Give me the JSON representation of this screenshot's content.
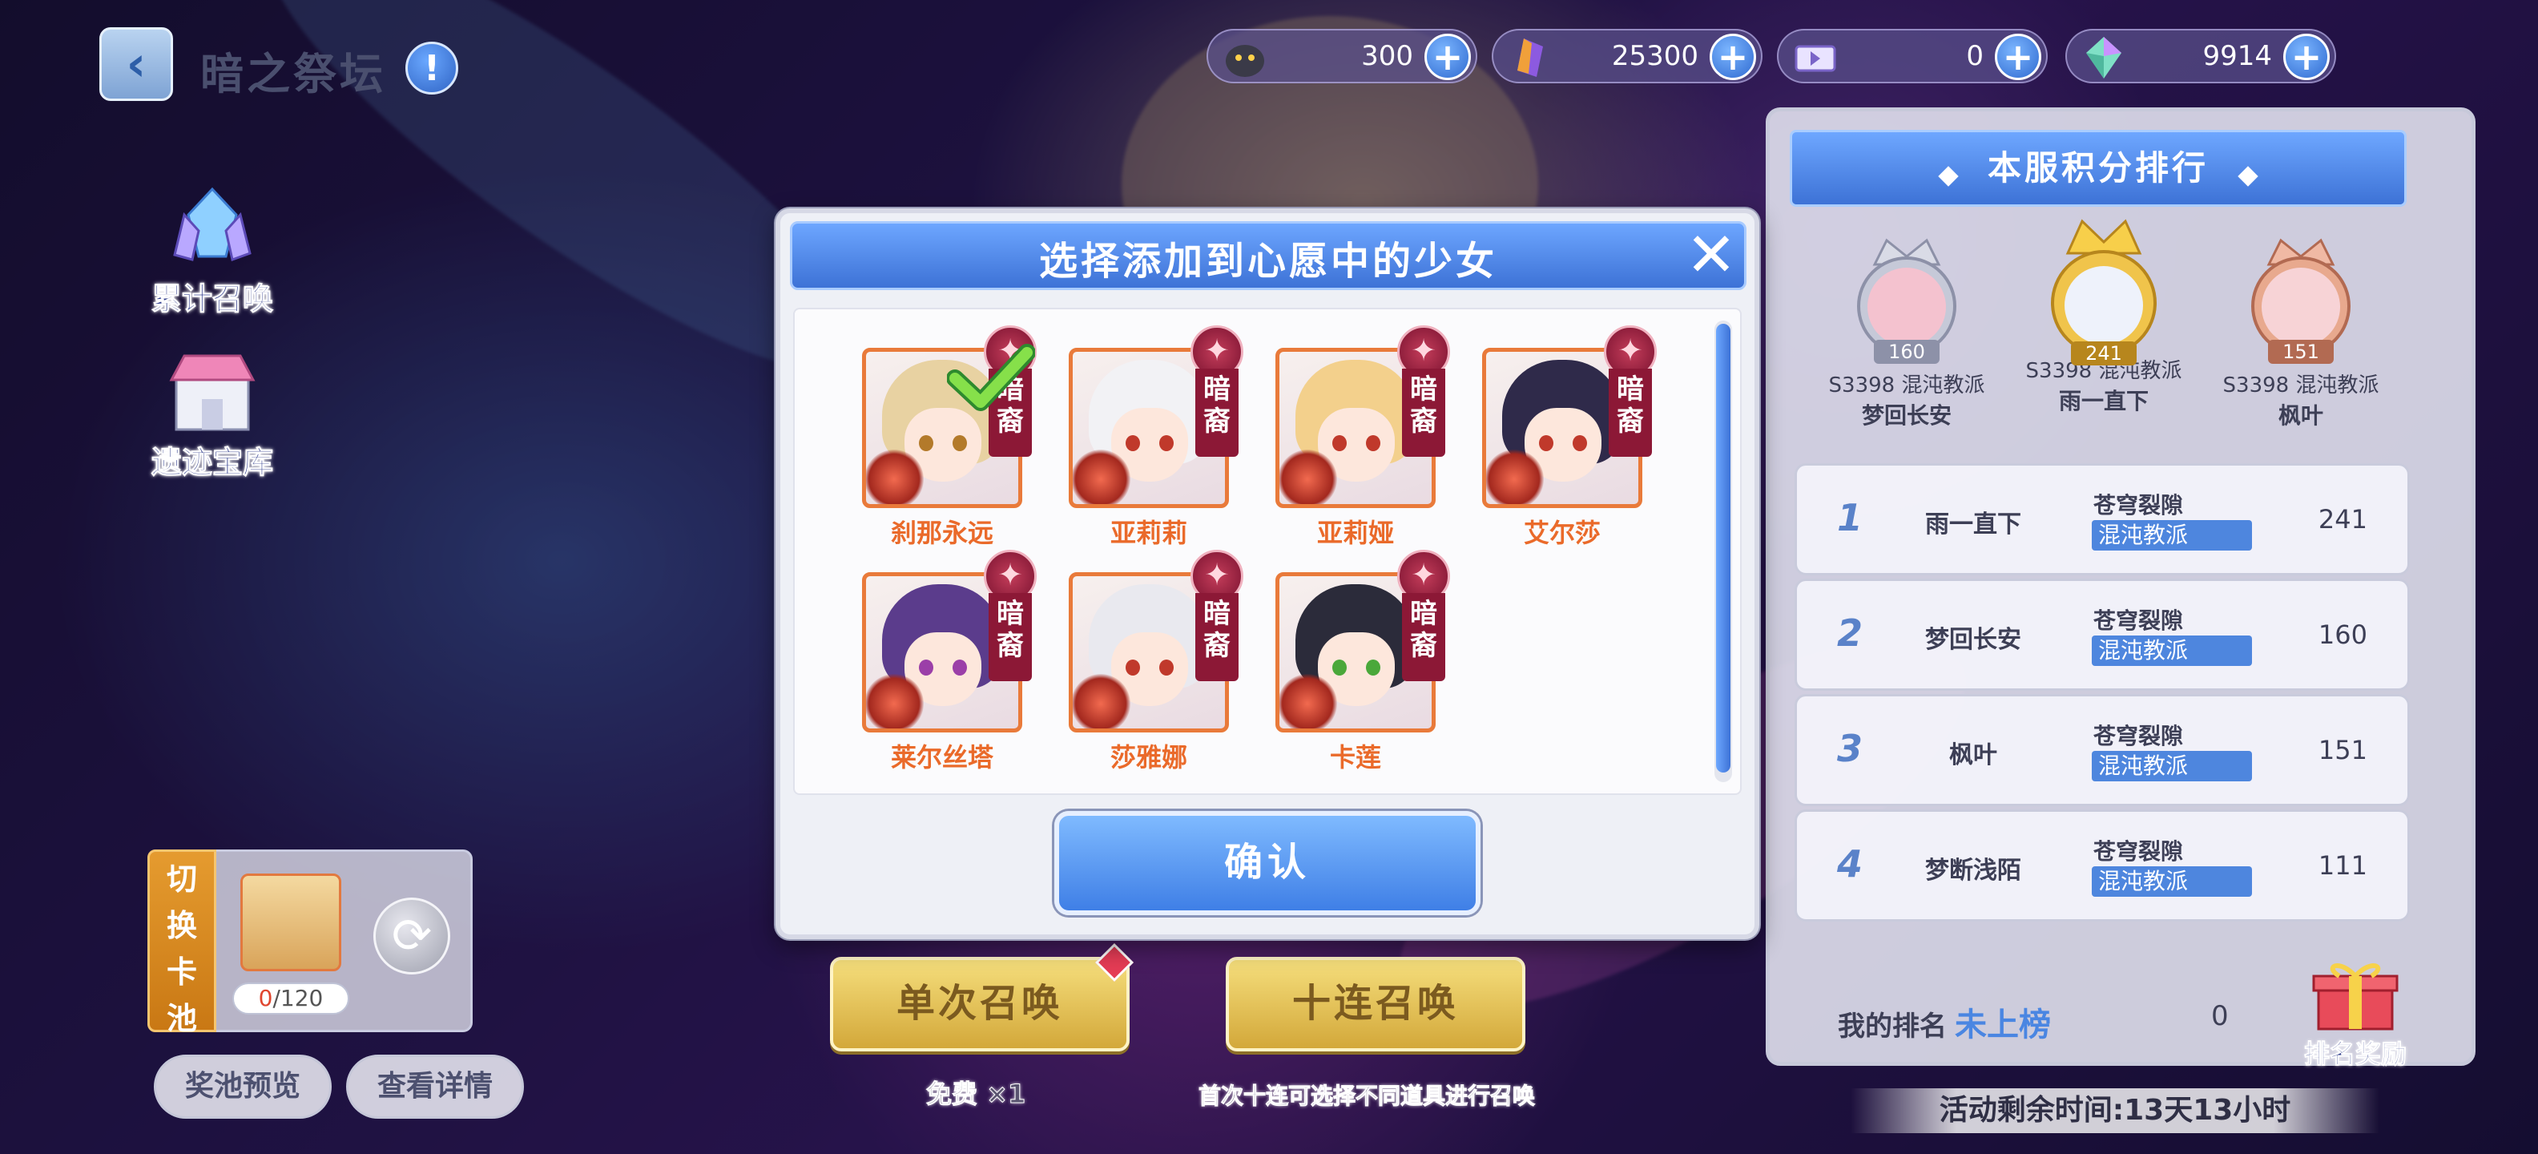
{
  "header": {
    "title": "暗之祭坛",
    "info_icon": "info-icon",
    "back_icon": "chevron-left-icon"
  },
  "resources": [
    {
      "name": "pet-food",
      "value": "300"
    },
    {
      "name": "crystal",
      "value": "25300"
    },
    {
      "name": "ticket",
      "value": "0"
    },
    {
      "name": "gem",
      "value": "9914"
    }
  ],
  "side_menu": {
    "cumulative_summon": "累计召唤",
    "relic_vault": "遗迹宝库"
  },
  "pool": {
    "switch_label": [
      "切",
      "换",
      "卡",
      "池"
    ],
    "count_current": "0",
    "count_total": "/120",
    "preview_btn": "奖池预览",
    "details_btn": "查看详情"
  },
  "summon": {
    "single_label": "单次召唤",
    "ten_label": "十连召唤",
    "single_sub": "免费 ×1",
    "ten_sub": "首次十连可选择不同道具进行召唤"
  },
  "modal": {
    "title": "选择添加到心愿中的少女",
    "confirm_label": "确认",
    "girls": [
      {
        "name": "刹那永远",
        "tag": "暗裔",
        "selected": true,
        "hair": "#e8d2a2"
      },
      {
        "name": "亚莉莉",
        "tag": "暗裔",
        "selected": false,
        "hair": "#f2f2f5"
      },
      {
        "name": "亚莉娅",
        "tag": "暗裔",
        "selected": false,
        "hair": "#f3d08c"
      },
      {
        "name": "艾尔莎",
        "tag": "暗裔",
        "selected": false,
        "hair": "#2f2a4a"
      },
      {
        "name": "莱尔丝塔",
        "tag": "暗裔",
        "selected": false,
        "hair": "#5b3c8c"
      },
      {
        "name": "莎雅娜",
        "tag": "暗裔",
        "selected": false,
        "hair": "#e9e9ef"
      },
      {
        "name": "卡莲",
        "tag": "暗裔",
        "selected": false,
        "hair": "#b7e08a"
      }
    ]
  },
  "ranking": {
    "title": "本服积分排行",
    "podium": [
      {
        "score": "160",
        "server": "S3398 混沌教派",
        "name": "梦回长安"
      },
      {
        "score": "241",
        "server": "S3398 混沌教派",
        "name": "雨一直下"
      },
      {
        "score": "151",
        "server": "S3398 混沌教派",
        "name": "枫叶"
      }
    ],
    "rows": [
      {
        "rank": "1",
        "name": "雨一直下",
        "server": "苍穹裂隙",
        "guild": "混沌教派",
        "points": "241"
      },
      {
        "rank": "2",
        "name": "梦回长安",
        "server": "苍穹裂隙",
        "guild": "混沌教派",
        "points": "160"
      },
      {
        "rank": "3",
        "name": "枫叶",
        "server": "苍穹裂隙",
        "guild": "混沌教派",
        "points": "151"
      },
      {
        "rank": "4",
        "name": "梦断浅陌",
        "server": "苍穹裂隙",
        "guild": "混沌教派",
        "points": "111"
      }
    ],
    "my_rank_label": "我的排名",
    "my_rank_value": "未上榜",
    "my_score": "0",
    "reward_label": "排名奖励"
  },
  "timer": "活动剩余时间:13天13小时"
}
